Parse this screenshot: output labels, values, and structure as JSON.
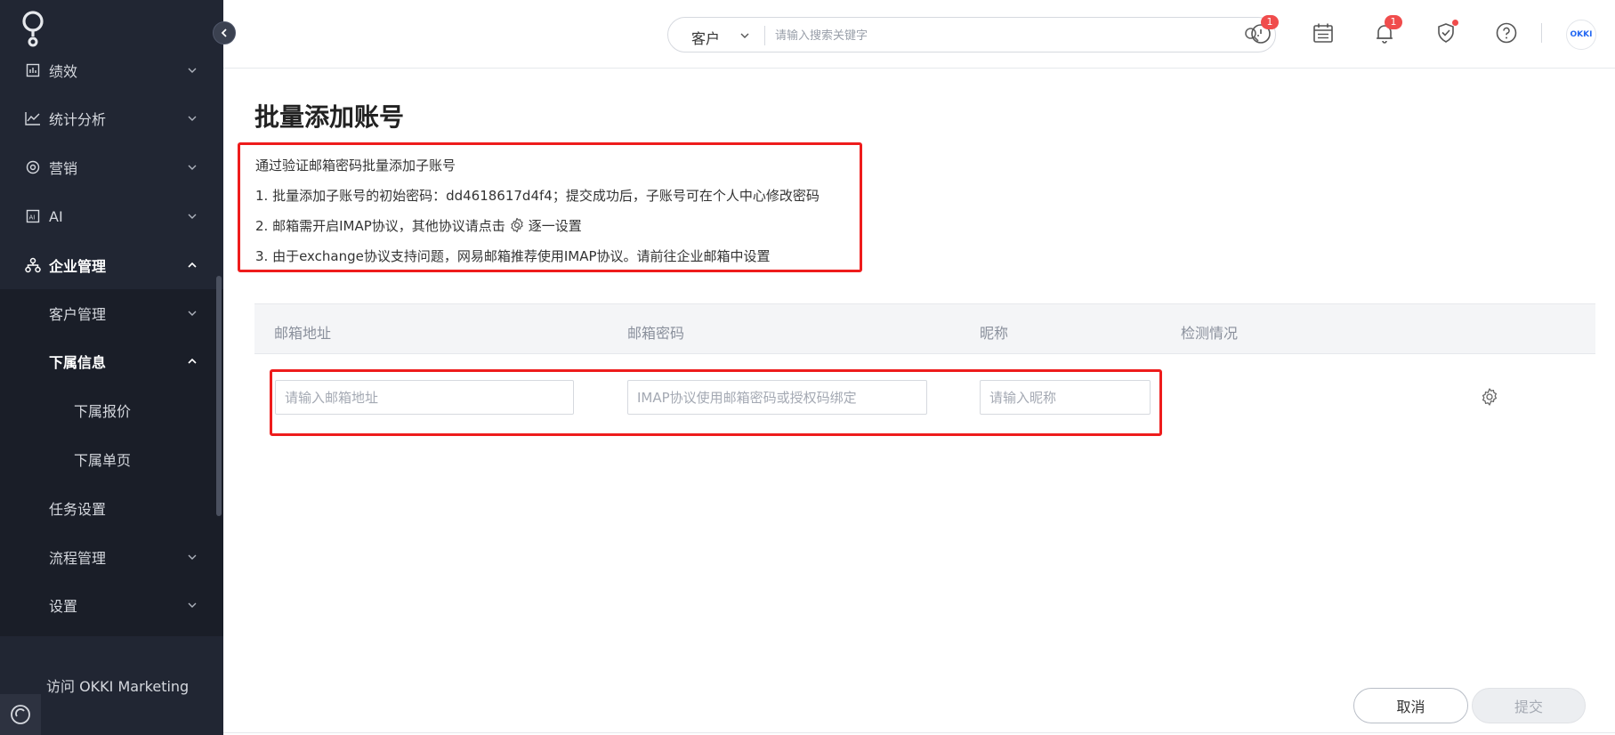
{
  "sidebar": {
    "items": [
      {
        "label": "绩效",
        "icon": "report-icon"
      },
      {
        "label": "统计分析",
        "icon": "chart-line-icon"
      },
      {
        "label": "营销",
        "icon": "target-icon"
      },
      {
        "label": "AI",
        "icon": "ai-icon"
      },
      {
        "label": "企业管理",
        "icon": "org-icon"
      },
      {
        "label": "客户管理"
      },
      {
        "label": "下属信息"
      },
      {
        "label": "下属报价"
      },
      {
        "label": "下属单页"
      },
      {
        "label": "任务设置"
      },
      {
        "label": "流程管理"
      },
      {
        "label": "设置"
      }
    ],
    "visit_link": "访问 OKKI Marketing"
  },
  "topbar": {
    "search_scope": "客户",
    "search_placeholder": "请输入搜索关键字",
    "timer_badge": "1",
    "bell_badge": "1",
    "avatar_text": "OKKI"
  },
  "main": {
    "title": "批量添加账号",
    "notice": {
      "line0": "通过验证邮箱密码批量添加子账号",
      "line1": "1. 批量添加子账号的初始密码：dd4618617d4f4；提交成功后，子账号可在个人中心修改密码",
      "line2_pre": "2. 邮箱需开启IMAP协议，其他协议请点击",
      "line2_post": "逐一设置",
      "line3": "3. 由于exchange协议支持问题，网易邮箱推荐使用IMAP协议。请前往企业邮箱中设置"
    },
    "table": {
      "headers": [
        "邮箱地址",
        "邮箱密码",
        "昵称",
        "检测情况"
      ],
      "row": {
        "email_placeholder": "请输入邮箱地址",
        "password_placeholder": "IMAP协议使用邮箱密码或授权码绑定",
        "nickname_placeholder": "请输入昵称"
      }
    },
    "buttons": {
      "cancel": "取消",
      "submit": "提交"
    }
  },
  "colors": {
    "sidebar_bg": "#212633",
    "highlight_red": "#ee1c1c",
    "badge_red": "#f04c4c",
    "brand_blue": "#2468f2"
  }
}
